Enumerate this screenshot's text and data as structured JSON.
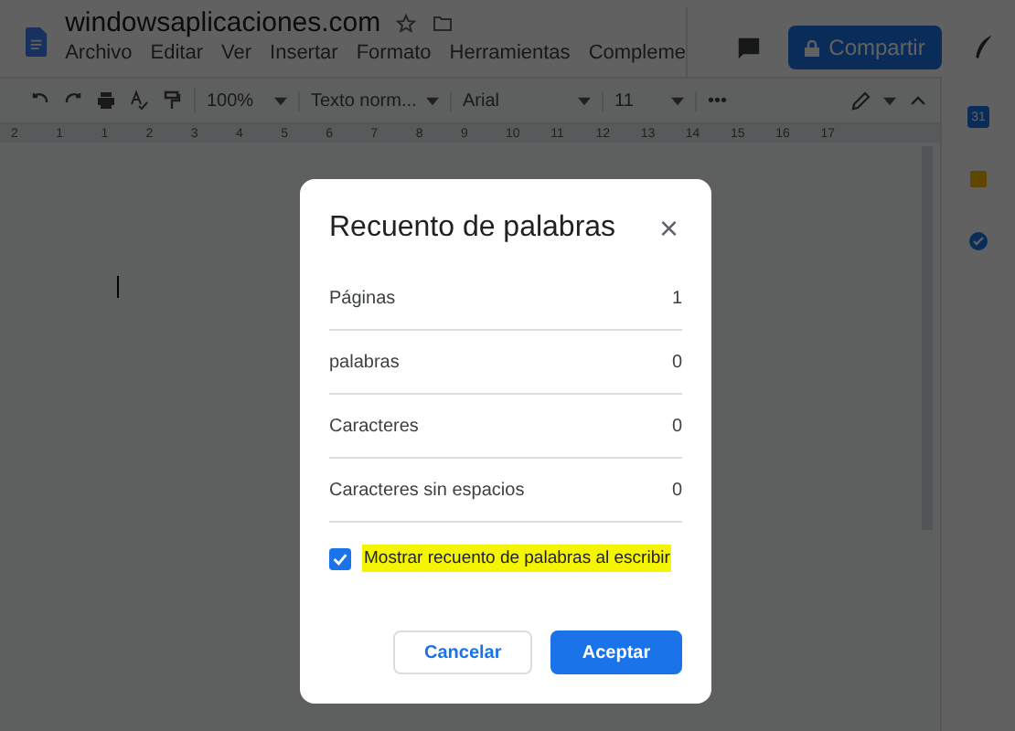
{
  "document": {
    "title": "windowsaplicaciones.com"
  },
  "menu": [
    "Archivo",
    "Editar",
    "Ver",
    "Insertar",
    "Formato",
    "Herramientas",
    "Compleme"
  ],
  "share_button": {
    "label": "Compartir"
  },
  "toolbar": {
    "zoom": "100%",
    "style": "Texto norm...",
    "font": "Arial",
    "size": "11",
    "more": "•••"
  },
  "ruler": [
    "2",
    "1",
    "1",
    "2",
    "3",
    "4",
    "5",
    "6",
    "7",
    "8",
    "9",
    "10",
    "11",
    "12",
    "13",
    "14",
    "15",
    "16",
    "17"
  ],
  "side_panel": {
    "calendar_day": "31"
  },
  "dialog": {
    "title": "Recuento de palabras",
    "close": "×",
    "rows": [
      {
        "label": "Páginas",
        "value": "1"
      },
      {
        "label": "palabras",
        "value": "0"
      },
      {
        "label": "Caracteres",
        "value": "0"
      },
      {
        "label": "Caracteres sin espacios",
        "value": "0"
      }
    ],
    "option": {
      "label": "Mostrar recuento de palabras al escribir",
      "checked": true,
      "highlighted": true
    },
    "buttons": [
      {
        "label": "Cancelar",
        "kind": "secondary"
      },
      {
        "label": "Aceptar",
        "kind": "primary"
      }
    ]
  }
}
